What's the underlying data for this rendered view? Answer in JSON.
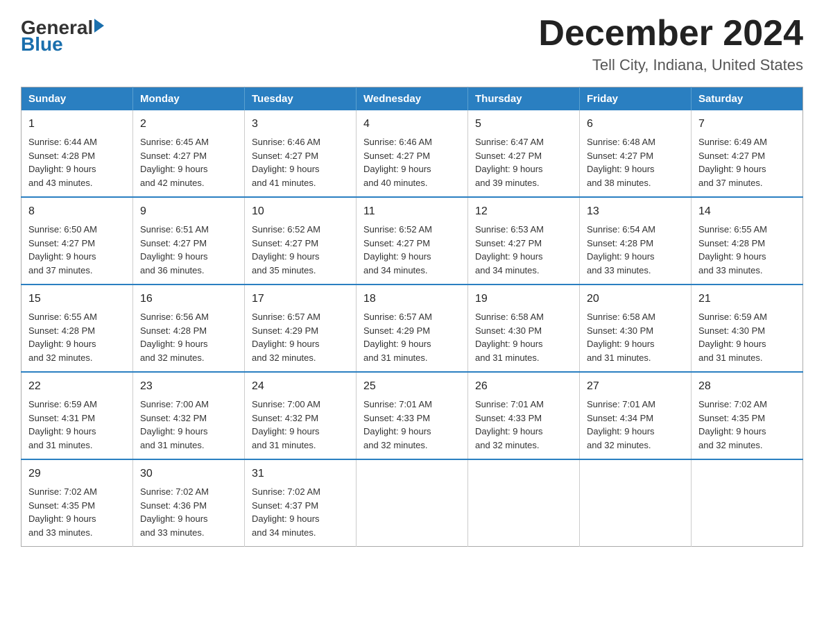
{
  "header": {
    "logo_general": "General",
    "logo_blue": "Blue",
    "month_year": "December 2024",
    "location": "Tell City, Indiana, United States"
  },
  "days_of_week": [
    "Sunday",
    "Monday",
    "Tuesday",
    "Wednesday",
    "Thursday",
    "Friday",
    "Saturday"
  ],
  "weeks": [
    [
      {
        "day": "1",
        "sunrise": "6:44 AM",
        "sunset": "4:28 PM",
        "daylight": "9 hours and 43 minutes."
      },
      {
        "day": "2",
        "sunrise": "6:45 AM",
        "sunset": "4:27 PM",
        "daylight": "9 hours and 42 minutes."
      },
      {
        "day": "3",
        "sunrise": "6:46 AM",
        "sunset": "4:27 PM",
        "daylight": "9 hours and 41 minutes."
      },
      {
        "day": "4",
        "sunrise": "6:46 AM",
        "sunset": "4:27 PM",
        "daylight": "9 hours and 40 minutes."
      },
      {
        "day": "5",
        "sunrise": "6:47 AM",
        "sunset": "4:27 PM",
        "daylight": "9 hours and 39 minutes."
      },
      {
        "day": "6",
        "sunrise": "6:48 AM",
        "sunset": "4:27 PM",
        "daylight": "9 hours and 38 minutes."
      },
      {
        "day": "7",
        "sunrise": "6:49 AM",
        "sunset": "4:27 PM",
        "daylight": "9 hours and 37 minutes."
      }
    ],
    [
      {
        "day": "8",
        "sunrise": "6:50 AM",
        "sunset": "4:27 PM",
        "daylight": "9 hours and 37 minutes."
      },
      {
        "day": "9",
        "sunrise": "6:51 AM",
        "sunset": "4:27 PM",
        "daylight": "9 hours and 36 minutes."
      },
      {
        "day": "10",
        "sunrise": "6:52 AM",
        "sunset": "4:27 PM",
        "daylight": "9 hours and 35 minutes."
      },
      {
        "day": "11",
        "sunrise": "6:52 AM",
        "sunset": "4:27 PM",
        "daylight": "9 hours and 34 minutes."
      },
      {
        "day": "12",
        "sunrise": "6:53 AM",
        "sunset": "4:27 PM",
        "daylight": "9 hours and 34 minutes."
      },
      {
        "day": "13",
        "sunrise": "6:54 AM",
        "sunset": "4:28 PM",
        "daylight": "9 hours and 33 minutes."
      },
      {
        "day": "14",
        "sunrise": "6:55 AM",
        "sunset": "4:28 PM",
        "daylight": "9 hours and 33 minutes."
      }
    ],
    [
      {
        "day": "15",
        "sunrise": "6:55 AM",
        "sunset": "4:28 PM",
        "daylight": "9 hours and 32 minutes."
      },
      {
        "day": "16",
        "sunrise": "6:56 AM",
        "sunset": "4:28 PM",
        "daylight": "9 hours and 32 minutes."
      },
      {
        "day": "17",
        "sunrise": "6:57 AM",
        "sunset": "4:29 PM",
        "daylight": "9 hours and 32 minutes."
      },
      {
        "day": "18",
        "sunrise": "6:57 AM",
        "sunset": "4:29 PM",
        "daylight": "9 hours and 31 minutes."
      },
      {
        "day": "19",
        "sunrise": "6:58 AM",
        "sunset": "4:30 PM",
        "daylight": "9 hours and 31 minutes."
      },
      {
        "day": "20",
        "sunrise": "6:58 AM",
        "sunset": "4:30 PM",
        "daylight": "9 hours and 31 minutes."
      },
      {
        "day": "21",
        "sunrise": "6:59 AM",
        "sunset": "4:30 PM",
        "daylight": "9 hours and 31 minutes."
      }
    ],
    [
      {
        "day": "22",
        "sunrise": "6:59 AM",
        "sunset": "4:31 PM",
        "daylight": "9 hours and 31 minutes."
      },
      {
        "day": "23",
        "sunrise": "7:00 AM",
        "sunset": "4:32 PM",
        "daylight": "9 hours and 31 minutes."
      },
      {
        "day": "24",
        "sunrise": "7:00 AM",
        "sunset": "4:32 PM",
        "daylight": "9 hours and 31 minutes."
      },
      {
        "day": "25",
        "sunrise": "7:01 AM",
        "sunset": "4:33 PM",
        "daylight": "9 hours and 32 minutes."
      },
      {
        "day": "26",
        "sunrise": "7:01 AM",
        "sunset": "4:33 PM",
        "daylight": "9 hours and 32 minutes."
      },
      {
        "day": "27",
        "sunrise": "7:01 AM",
        "sunset": "4:34 PM",
        "daylight": "9 hours and 32 minutes."
      },
      {
        "day": "28",
        "sunrise": "7:02 AM",
        "sunset": "4:35 PM",
        "daylight": "9 hours and 32 minutes."
      }
    ],
    [
      {
        "day": "29",
        "sunrise": "7:02 AM",
        "sunset": "4:35 PM",
        "daylight": "9 hours and 33 minutes."
      },
      {
        "day": "30",
        "sunrise": "7:02 AM",
        "sunset": "4:36 PM",
        "daylight": "9 hours and 33 minutes."
      },
      {
        "day": "31",
        "sunrise": "7:02 AM",
        "sunset": "4:37 PM",
        "daylight": "9 hours and 34 minutes."
      },
      null,
      null,
      null,
      null
    ]
  ]
}
